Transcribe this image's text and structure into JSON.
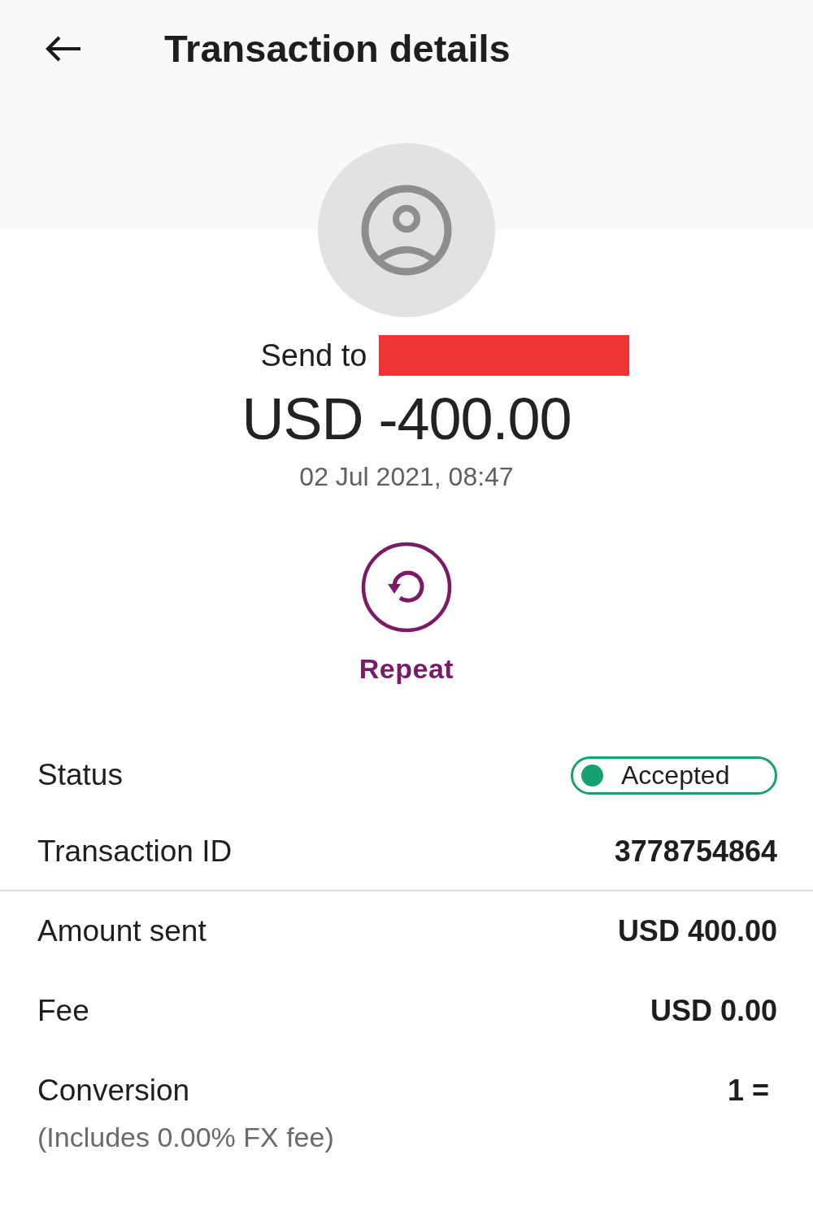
{
  "header": {
    "title": "Transaction details"
  },
  "recipient": {
    "label": "Send to",
    "redacted": true
  },
  "amount": "USD -400.00",
  "date": "02 Jul 2021, 08:47",
  "actions": [
    {
      "label": "Repeat"
    }
  ],
  "details": [
    {
      "kind": "status",
      "label": "Status",
      "value": "Accepted",
      "color": "#17a072"
    },
    {
      "kind": "text",
      "label": "Transaction ID",
      "value": "3778754864"
    }
  ],
  "breakdown": [
    {
      "label": "Amount sent",
      "value": "USD 400.00"
    },
    {
      "label": "Fee",
      "value": "USD 0.00"
    },
    {
      "label": "Conversion",
      "value": "1 =",
      "note": "(Includes 0.00% FX fee)"
    }
  ]
}
